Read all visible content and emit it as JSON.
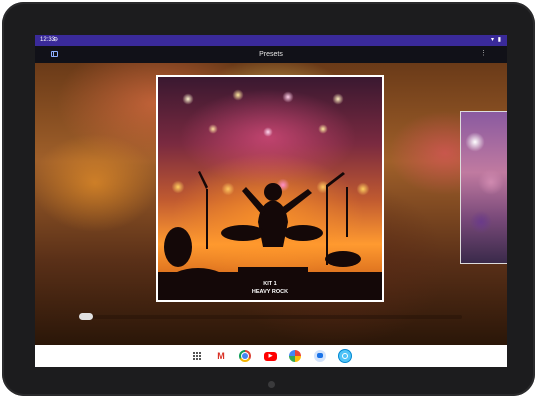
{
  "statusbar": {
    "time": "12:33",
    "alert_icon": "info-icon",
    "icons": "wifi-icon battery-icon"
  },
  "appbar": {
    "title": "Presets",
    "left_icon": "sidebar-icon",
    "menu_icon": "more-vert-icon"
  },
  "presets": [
    {
      "label_line1": "KIT 1",
      "label_line2": "HEAVY ROCK"
    }
  ],
  "taskbar": {
    "apps": [
      "app-drawer-icon",
      "gmail-icon",
      "chrome-icon",
      "youtube-icon",
      "photos-icon",
      "messages-icon",
      "app-icon"
    ]
  },
  "colors": {
    "statusbar": "#3a2a9a",
    "appbar": "#111118",
    "taskbar": "#ffffff"
  }
}
